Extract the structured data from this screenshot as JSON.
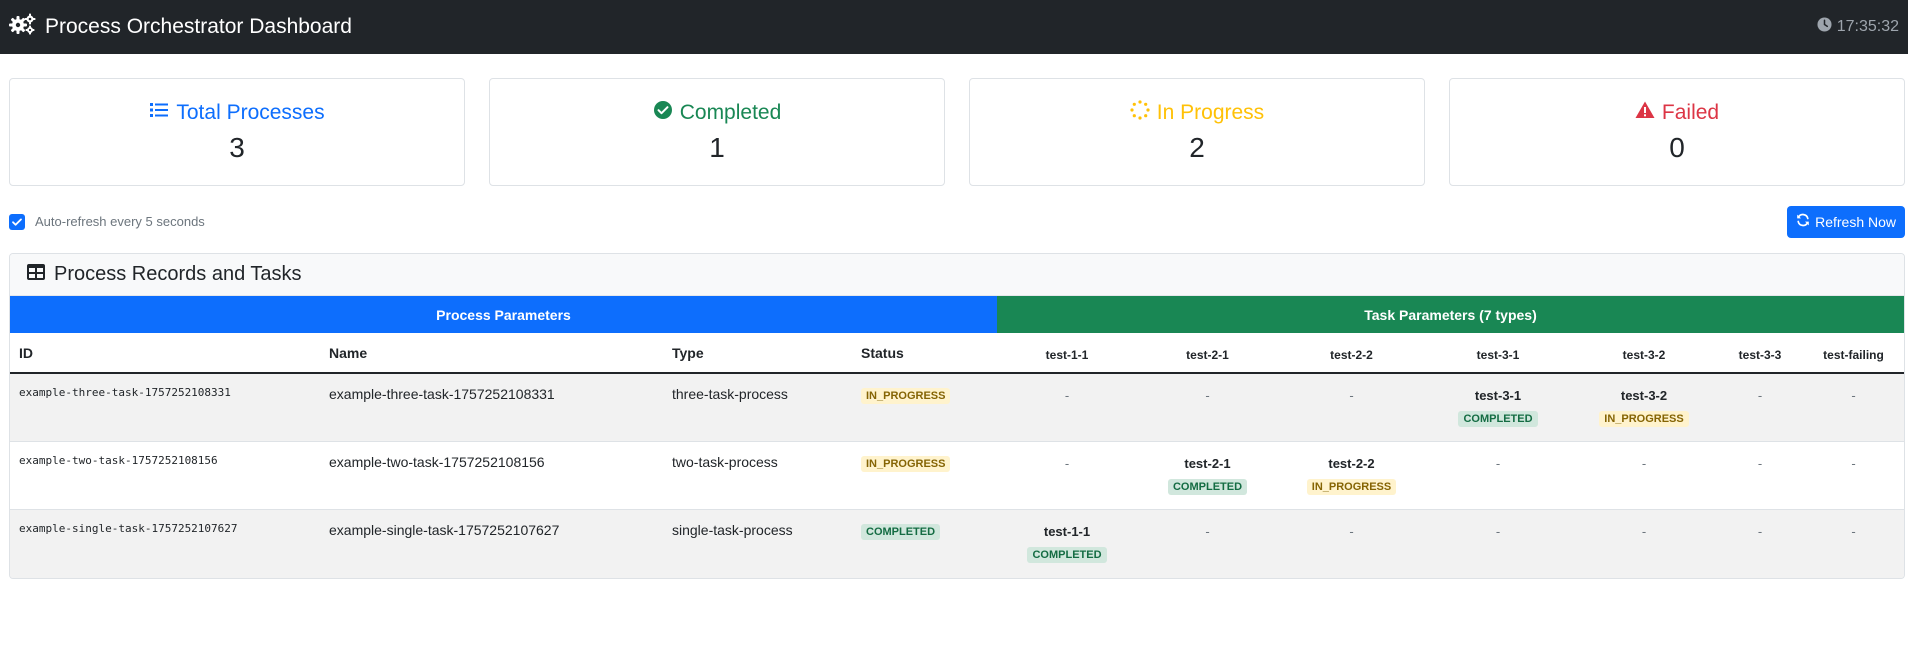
{
  "header": {
    "title": "Process Orchestrator Dashboard",
    "time": "17:35:32"
  },
  "cards": [
    {
      "label": "Total Processes",
      "value": "3",
      "color": "#0d6efd",
      "icon": "list-icon"
    },
    {
      "label": "Completed",
      "value": "1",
      "color": "#198754",
      "icon": "check-circle-icon"
    },
    {
      "label": "In Progress",
      "value": "2",
      "color": "#ffc107",
      "icon": "spinner-icon"
    },
    {
      "label": "Failed",
      "value": "0",
      "color": "#dc3545",
      "icon": "warning-triangle-icon"
    }
  ],
  "controls": {
    "auto_refresh_label": "Auto-refresh every 5 seconds",
    "auto_refresh_checked": true,
    "refresh_button": "Refresh Now"
  },
  "panel": {
    "title": "Process Records and Tasks",
    "group_process": "Process Parameters",
    "group_tasks": "Task Parameters (7 types)",
    "columns": [
      "ID",
      "Name",
      "Type",
      "Status"
    ],
    "task_columns": [
      "test-1-1",
      "test-2-1",
      "test-2-2",
      "test-3-1",
      "test-3-2",
      "test-3-3",
      "test-failing"
    ]
  },
  "rows": [
    {
      "id": "example-three-task-1757252108331",
      "name": "example-three-task-1757252108331",
      "type": "three-task-process",
      "status": "IN_PROGRESS",
      "tasks": [
        null,
        null,
        null,
        {
          "name": "test-3-1",
          "status": "COMPLETED"
        },
        {
          "name": "test-3-2",
          "status": "IN_PROGRESS"
        },
        null,
        null
      ]
    },
    {
      "id": "example-two-task-1757252108156",
      "name": "example-two-task-1757252108156",
      "type": "two-task-process",
      "status": "IN_PROGRESS",
      "tasks": [
        null,
        {
          "name": "test-2-1",
          "status": "COMPLETED"
        },
        {
          "name": "test-2-2",
          "status": "IN_PROGRESS"
        },
        null,
        null,
        null,
        null
      ]
    },
    {
      "id": "example-single-task-1757252107627",
      "name": "example-single-task-1757252107627",
      "type": "single-task-process",
      "status": "COMPLETED",
      "tasks": [
        {
          "name": "test-1-1",
          "status": "COMPLETED"
        },
        null,
        null,
        null,
        null,
        null,
        null
      ]
    }
  ],
  "empty_cell": "-"
}
